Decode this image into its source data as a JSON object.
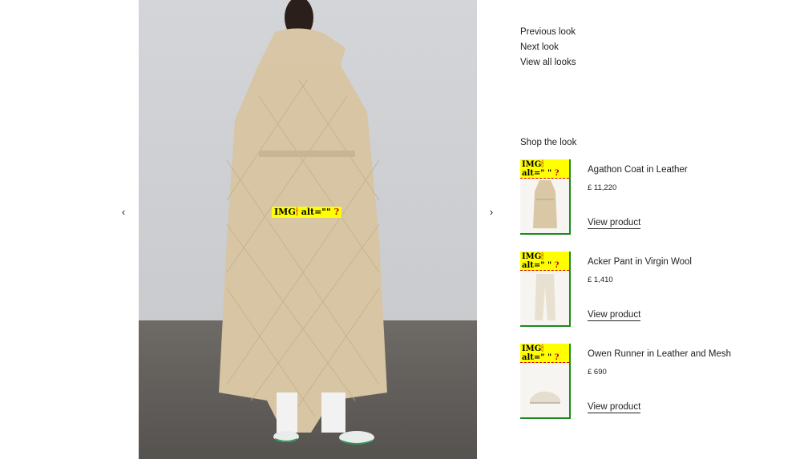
{
  "look": {
    "image_alt_badge": "IMG",
    "image_alt_text": "alt=\"\"",
    "prev_arrow": "‹",
    "next_arrow": "›"
  },
  "look_nav": {
    "previous": "Previous look",
    "next": "Next look",
    "view_all": "View all looks"
  },
  "shop": {
    "title": "Shop the look",
    "view_label": "View product",
    "products": [
      {
        "name": "Agathon Coat in Leather",
        "price": "£ 11,220",
        "badge_top": "IMG",
        "badge_alt": "alt=\" \""
      },
      {
        "name": "Acker Pant in Virgin Wool",
        "price": "£ 1,410",
        "badge_top": "IMG",
        "badge_alt": "alt=\" \""
      },
      {
        "name": "Owen Runner in Leather and Mesh",
        "price": "£ 690",
        "badge_top": "IMG",
        "badge_alt": "alt=\" \""
      }
    ]
  }
}
